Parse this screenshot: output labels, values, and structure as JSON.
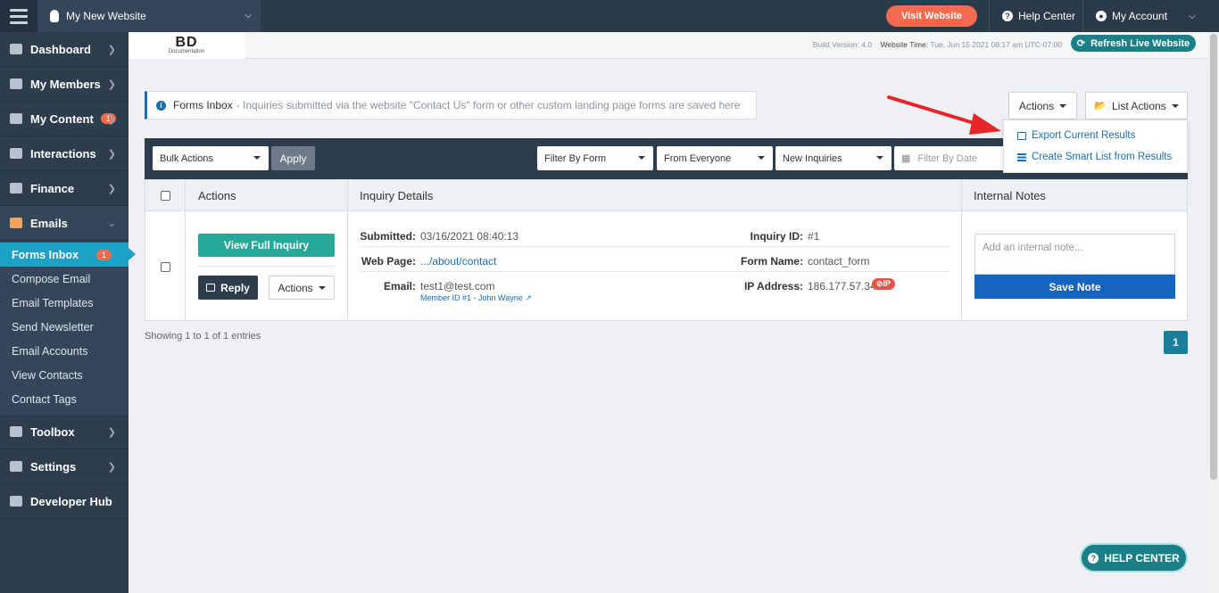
{
  "topbar": {
    "site_name": "My New Website",
    "visit_label": "Visit Website",
    "help_label": "Help Center",
    "account_label": "My Account"
  },
  "header": {
    "logo_text": "BD",
    "logo_sub": "Documentation",
    "build_label": "Build Version: 4.0",
    "time_label": "Website Time:",
    "time_value": "Tue, Jun 15 2021 08:17 am UTC-07:00",
    "refresh_label": "Refresh Live Website"
  },
  "sidebar": {
    "items": [
      {
        "label": "Dashboard"
      },
      {
        "label": "My Members"
      },
      {
        "label": "My Content",
        "badge": "1"
      },
      {
        "label": "Interactions"
      },
      {
        "label": "Finance"
      },
      {
        "label": "Emails"
      }
    ],
    "subitems": [
      {
        "label": "Forms Inbox",
        "badge": "1"
      },
      {
        "label": "Compose Email"
      },
      {
        "label": "Email Templates"
      },
      {
        "label": "Send Newsletter"
      },
      {
        "label": "Email Accounts"
      },
      {
        "label": "View Contacts"
      },
      {
        "label": "Contact Tags"
      }
    ],
    "bottom": [
      {
        "label": "Toolbox"
      },
      {
        "label": "Settings"
      },
      {
        "label": "Developer Hub"
      }
    ]
  },
  "info": {
    "title": "Forms Inbox",
    "desc": "- Inquiries submitted via the website \"Contact Us\" form or other custom landing page forms are saved here"
  },
  "actions": {
    "actions_label": "Actions",
    "list_actions_label": "List Actions",
    "menu": [
      "Export Current Results",
      "Create Smart List from Results"
    ]
  },
  "filters": {
    "bulk": "Bulk Actions",
    "apply": "Apply",
    "by_form": "Filter By Form",
    "from": "From Everyone",
    "status": "New Inquiries",
    "date_placeholder": "Filter By Date"
  },
  "table": {
    "headers": {
      "actions": "Actions",
      "details": "Inquiry Details",
      "notes": "Internal Notes"
    },
    "row": {
      "view_btn": "View Full Inquiry",
      "reply_btn": "Reply",
      "actions_btn": "Actions",
      "submitted_label": "Submitted:",
      "submitted_value": "03/16/2021 08:40:13",
      "webpage_label": "Web Page:",
      "webpage_value": ".../about/contact",
      "email_label": "Email:",
      "email_value": "test1@test.com",
      "member_link": "Member ID #1 - John Wayne",
      "inquiry_id_label": "Inquiry ID:",
      "inquiry_id_value": "#1",
      "form_name_label": "Form Name:",
      "form_name_value": "contact_form",
      "ip_label": "IP Address:",
      "ip_value": "186.177.57.34",
      "ip_badge": "IP",
      "note_placeholder": "Add an internal note...",
      "save_note": "Save Note"
    }
  },
  "footer": {
    "showing": "Showing 1 to 1 of 1 entries",
    "page": "1",
    "help_float": "HELP CENTER"
  },
  "colors": {
    "accent": "#1da1c6",
    "orange": "#f26b4f",
    "navy": "#2e3d4d",
    "annotation_arrow": "#e8262a"
  }
}
